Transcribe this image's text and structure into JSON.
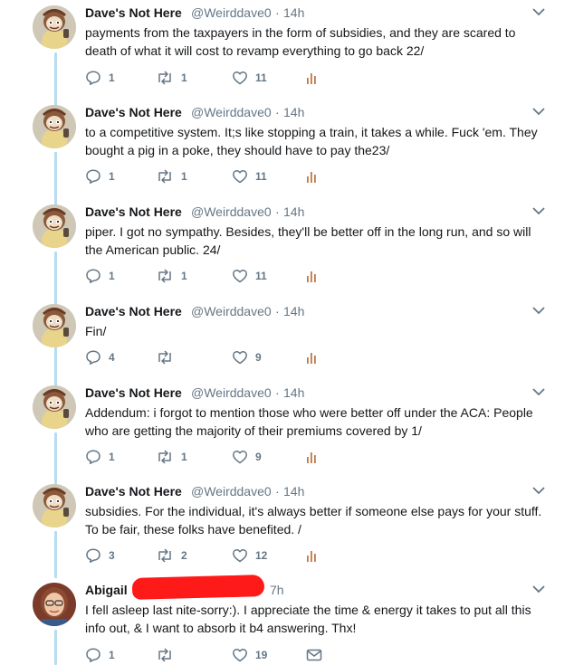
{
  "colors": {
    "thread_line": "#b5dcf2",
    "text": "#14171a",
    "meta": "#657786",
    "redaction": "#ff1a1a"
  },
  "tweets": [
    {
      "name": "Dave's Not Here",
      "handle": "@Weirddave0",
      "time": "14h",
      "text": "payments from the taxpayers in the form of subsidies, and they are scared to death of what it will cost to revamp everything to go back 22/",
      "replies": "1",
      "retweets": "1",
      "likes": "11"
    },
    {
      "name": "Dave's Not Here",
      "handle": "@Weirddave0",
      "time": "14h",
      "text": "to a competitive system. It;s like stopping a train, it takes a while. Fuck 'em. They bought a pig in a poke, they should have to pay the23/",
      "replies": "1",
      "retweets": "1",
      "likes": "11"
    },
    {
      "name": "Dave's Not Here",
      "handle": "@Weirddave0",
      "time": "14h",
      "text": "piper. I got no sympathy. Besides, they'll be better off in the long run, and so will the American public. 24/",
      "replies": "1",
      "retweets": "1",
      "likes": "11"
    },
    {
      "name": "Dave's Not Here",
      "handle": "@Weirddave0",
      "time": "14h",
      "text": "Fin/",
      "replies": "4",
      "retweets": "",
      "likes": "9"
    },
    {
      "name": "Dave's Not Here",
      "handle": "@Weirddave0",
      "time": "14h",
      "text": "Addendum: i forgot to mention those who were better off under the ACA: People who are getting the majority of their premiums covered by 1/",
      "replies": "1",
      "retweets": "1",
      "likes": "9"
    },
    {
      "name": "Dave's Not Here",
      "handle": "@Weirddave0",
      "time": "14h",
      "text": "subsidies. For the individual, it's always better if someone else pays for your stuff. To be fair, these folks have benefited. /",
      "replies": "3",
      "retweets": "2",
      "likes": "12"
    },
    {
      "name": "Abigail",
      "handle": "",
      "time": "7h",
      "text": "I fell asleep last nite-sorry:). I appreciate the time & energy it takes to put all this info out, & I want to absorb it b4 answering. Thx!",
      "replies": "1",
      "retweets": "",
      "likes": "19"
    }
  ]
}
